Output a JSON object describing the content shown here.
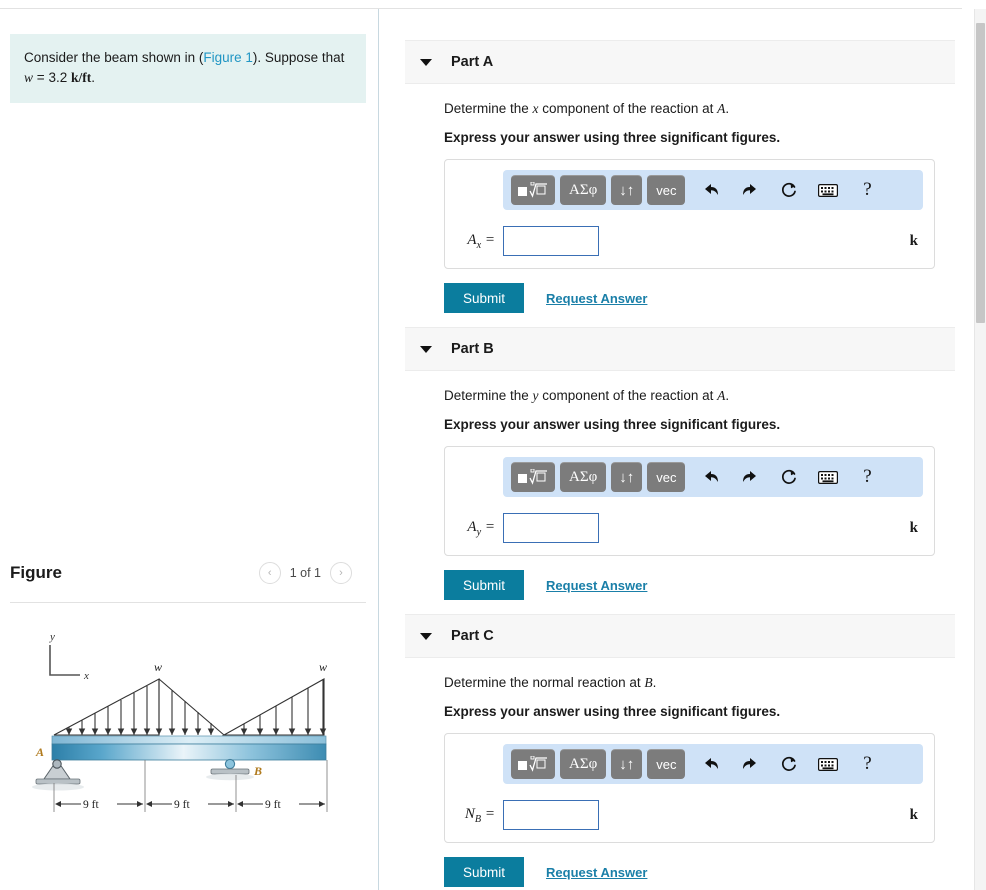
{
  "problem": {
    "text_before_link": "Consider the beam shown in (",
    "figure_link": "Figure 1",
    "text_after_link": "). Suppose that",
    "variable": "w",
    "equals": "=",
    "value": "3.2",
    "unit": "k/ft",
    "period": "."
  },
  "figure_panel": {
    "title": "Figure",
    "prev_label": "‹",
    "next_label": "›",
    "counter": "1 of 1"
  },
  "figure_diagram": {
    "axis_y_label": "y",
    "axis_x_label": "x",
    "load_label_left": "w",
    "load_label_right": "w",
    "support_a_label": "A",
    "support_b_label": "B",
    "dim_1": "9 ft",
    "dim_2": "9 ft",
    "dim_3": "9 ft",
    "beam_color_dark": "#2d7fa8",
    "beam_color_light": "#eaf4f9"
  },
  "toolbar": {
    "template_button": "√",
    "greek_button": "ΑΣφ",
    "script_button": "↓↑",
    "vec_button": "vec",
    "undo_icon": "undo-icon",
    "redo_icon": "redo-icon",
    "reset_icon": "reset-icon",
    "keyboard_icon": "keyboard-icon",
    "help_label": "?"
  },
  "common": {
    "significant_figures_note": "Express your answer using three significant figures.",
    "submit_label": "Submit",
    "request_answer_label": "Request Answer",
    "unit_label": "k",
    "caret_icon": "caret-down-icon",
    "accent_color": "#0b7d9e",
    "link_color": "#1a7fa8",
    "mathbar_color": "#cfe2f7"
  },
  "parts": [
    {
      "id": "A",
      "title": "Part A",
      "prompt_prefix": "Determine the ",
      "prompt_var": "x",
      "prompt_suffix": " component of the reaction at ",
      "prompt_point": "A",
      "prompt_end": ".",
      "answer_symbol": "A",
      "answer_subscript": "x",
      "answer_value": "",
      "answer_placeholder": ""
    },
    {
      "id": "B",
      "title": "Part B",
      "prompt_prefix": "Determine the ",
      "prompt_var": "y",
      "prompt_suffix": " component of the reaction at ",
      "prompt_point": "A",
      "prompt_end": ".",
      "answer_symbol": "A",
      "answer_subscript": "y",
      "answer_value": "",
      "answer_placeholder": ""
    },
    {
      "id": "C",
      "title": "Part C",
      "prompt_prefix": "Determine the normal reaction at ",
      "prompt_var": "",
      "prompt_suffix": "",
      "prompt_point": "B",
      "prompt_end": ".",
      "answer_symbol": "N",
      "answer_subscript": "B",
      "answer_value": "",
      "answer_placeholder": ""
    }
  ]
}
